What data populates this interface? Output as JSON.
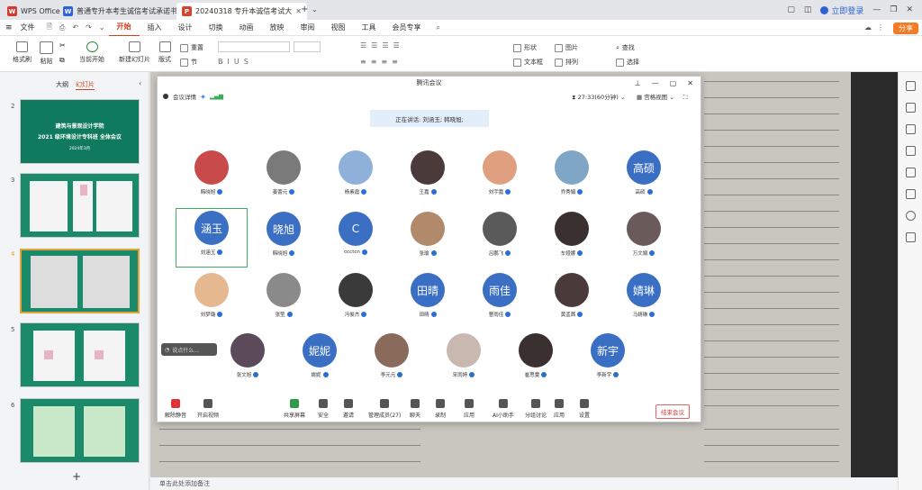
{
  "tabs": [
    {
      "label": "WPS Office",
      "icon": "wps-logo-icon",
      "color": "#d63a2f"
    },
    {
      "label": "普通专升本考生诚信考试承诺书.docx",
      "icon": "word-doc-icon",
      "color": "#2f62d6"
    },
    {
      "label": "20240318 专升本诚信考试大",
      "icon": "ppt-doc-icon",
      "color": "#d4442f"
    }
  ],
  "window": {
    "login": "立即登录"
  },
  "menu": {
    "file": "文件",
    "items": [
      "开始",
      "插入",
      "设计",
      "切换",
      "动画",
      "放映",
      "审阅",
      "视图",
      "工具",
      "会员专享"
    ],
    "active": "开始",
    "share": "分享"
  },
  "ribbon": {
    "format_painter": "格式刷",
    "paste": "粘贴",
    "current_start": "当前开始",
    "new_slide": "新建幻灯片",
    "layout": "版式",
    "section": "节",
    "reset": "重置",
    "shape": "形状",
    "picture": "图片",
    "find": "查找",
    "textbox": "文本框",
    "arrange": "排列",
    "select": "选择"
  },
  "left_panel": {
    "tab_outline": "大纲",
    "tab_slides": "幻灯片",
    "slide_title_line1": "建筑与景观设计学院",
    "slide_title_line2": "2021 级环境设计专科班 全体会议",
    "slide_date": "2024年3月",
    "slide_numbers": [
      "2",
      "3",
      "4",
      "5",
      "6"
    ],
    "add": "+"
  },
  "status": {
    "note": "单击此处添加备注"
  },
  "meeting": {
    "title": "腾讯会议",
    "info": "会议详情",
    "timer": "27:33(60分钟)",
    "view": "宫格视图",
    "speaking": "正在讲话: 刘涵玉; 韩晓旭;",
    "participants": [
      {
        "name": "韩晓旭",
        "avatar": "photo",
        "color": "#c94a4a"
      },
      {
        "name": "姜蕾元",
        "avatar": "photo",
        "color": "#7a7a7a"
      },
      {
        "name": "杨素霞",
        "avatar": "photo",
        "color": "#8fb0d8"
      },
      {
        "name": "王嘉",
        "avatar": "photo",
        "color": "#4a3a3a"
      },
      {
        "name": "刘宇嘉",
        "avatar": "photo",
        "color": "#e0a080"
      },
      {
        "name": "乔秀娟",
        "avatar": "photo",
        "color": "#7fa6c4"
      },
      {
        "name": "高硕",
        "avatar": "text",
        "text": "高硕"
      },
      {
        "name": "刘涵玉",
        "avatar": "text",
        "text": "涵玉"
      },
      {
        "name": "韩晓旭",
        "avatar": "text",
        "text": "晓旭"
      },
      {
        "name": "ccctcn",
        "avatar": "text",
        "text": "C"
      },
      {
        "name": "张瑜",
        "avatar": "photo",
        "color": "#b08a6a"
      },
      {
        "name": "吕鹏飞",
        "avatar": "photo",
        "color": "#5a5a5a"
      },
      {
        "name": "车娅娜",
        "avatar": "photo",
        "color": "#3a3030"
      },
      {
        "name": "万文娟",
        "avatar": "photo",
        "color": "#6a5a5a"
      },
      {
        "name": "刘梦璐",
        "avatar": "photo",
        "color": "#e6b890"
      },
      {
        "name": "张莹",
        "avatar": "photo",
        "color": "#8a8a8a"
      },
      {
        "name": "冯俊杰",
        "avatar": "photo",
        "color": "#3a3a3a"
      },
      {
        "name": "田晴",
        "avatar": "text",
        "text": "田晴"
      },
      {
        "name": "曹雨佳",
        "avatar": "text",
        "text": "雨佳"
      },
      {
        "name": "黄孟茜",
        "avatar": "photo",
        "color": "#4a3a3a"
      },
      {
        "name": "马婧琳",
        "avatar": "text",
        "text": "婧琳"
      },
      {
        "name": "张文旭",
        "avatar": "photo",
        "color": "#5a4a5a"
      },
      {
        "name": "姚妮",
        "avatar": "text",
        "text": "妮妮"
      },
      {
        "name": "李元元",
        "avatar": "photo",
        "color": "#8a6a5a"
      },
      {
        "name": "宋雨婷",
        "avatar": "photo",
        "color": "#c8b8b0"
      },
      {
        "name": "崔思雯",
        "avatar": "photo",
        "color": "#3a3030"
      },
      {
        "name": "李新宇",
        "avatar": "text",
        "text": "新宇"
      }
    ],
    "chat_placeholder": "说点什么...",
    "toolbar": [
      "解除静音",
      "开启视频",
      "共享屏幕",
      "安全",
      "邀请",
      "管理成员(27)",
      "聊天",
      "录制",
      "应用",
      "AI小助手",
      "分组讨论",
      "应用",
      "设置"
    ],
    "toolbar_icons": [
      "mic-icon",
      "video-icon",
      "share-screen-icon",
      "shield-icon",
      "invite-icon",
      "members-icon",
      "chat-icon",
      "record-icon",
      "apps-icon",
      "ai-assistant-icon",
      "breakout-icon",
      "apps-grid-icon",
      "settings-icon"
    ],
    "end": "结束会议"
  }
}
